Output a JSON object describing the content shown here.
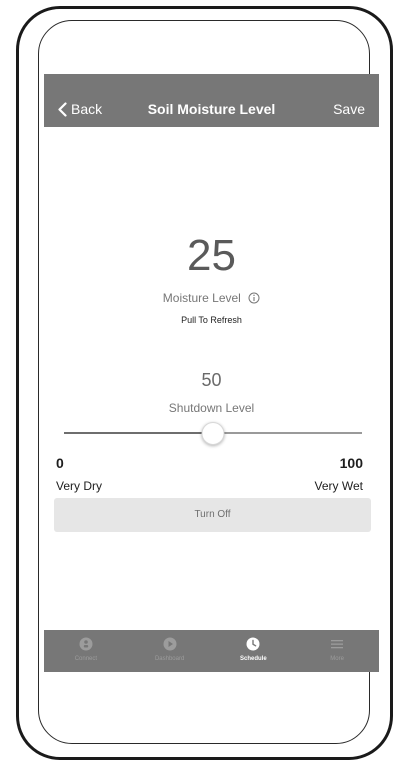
{
  "nav": {
    "back_label": "Back",
    "title": "Soil Moisture Level",
    "save_label": "Save"
  },
  "moisture": {
    "value": "25",
    "label": "Moisture Level",
    "refresh_hint": "Pull To Refresh"
  },
  "shutdown": {
    "value": "50",
    "label": "Shutdown Level",
    "slider_fraction": 0.5
  },
  "scale": {
    "min": "0",
    "max": "100",
    "min_label": "Very Dry",
    "max_label": "Very Wet"
  },
  "actions": {
    "turn_off_label": "Turn Off"
  },
  "tabbar": {
    "tabs": [
      {
        "label": "Connect",
        "icon": "connect-icon",
        "active": false
      },
      {
        "label": "Dashboard",
        "icon": "play-icon",
        "active": false
      },
      {
        "label": "Schedule",
        "icon": "clock-icon",
        "active": true
      },
      {
        "label": "More",
        "icon": "menu-icon",
        "active": false
      }
    ]
  },
  "colors": {
    "bar": "#777777",
    "inactive_tab": "#9c9c9c",
    "active_tab": "#ffffff",
    "button_bg": "#e6e6e6"
  }
}
